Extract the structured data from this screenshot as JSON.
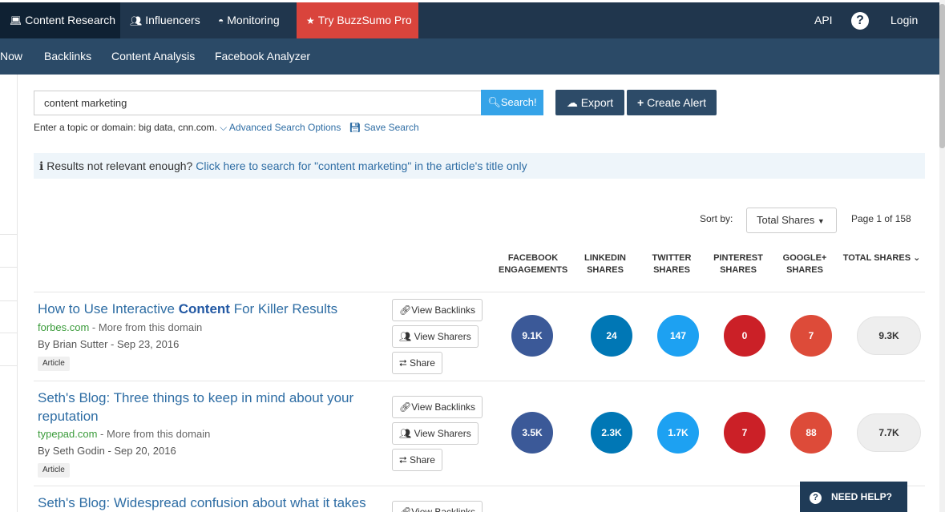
{
  "topnav": {
    "content_research": "Content Research",
    "influencers": "Influencers",
    "monitoring": "Monitoring",
    "try_pro": "Try BuzzSumo Pro",
    "api": "API",
    "help_glyph": "?",
    "login": "Login"
  },
  "subnav": {
    "now": "Now",
    "backlinks": "Backlinks",
    "content_analysis": "Content Analysis",
    "facebook_analyzer": "Facebook Analyzer"
  },
  "search": {
    "value": "content marketing",
    "button": "Search!",
    "export": "Export",
    "create_alert": "Create Alert",
    "hint": "Enter a topic or domain: big data, cnn.com.",
    "advanced": "Advanced Search Options",
    "save": "Save Search"
  },
  "notice": {
    "prefix": "Results not relevant enough?",
    "link": "Click here to search for \"content marketing\" in the article's title only"
  },
  "sort": {
    "label": "Sort by:",
    "selected": "Total Shares",
    "page_info": "Page 1 of 158"
  },
  "columns": [
    {
      "l1": "FACEBOOK",
      "l2": "ENGAGEMENTS"
    },
    {
      "l1": "LINKEDIN",
      "l2": "SHARES"
    },
    {
      "l1": "TWITTER",
      "l2": "SHARES"
    },
    {
      "l1": "PINTEREST",
      "l2": "SHARES"
    },
    {
      "l1": "GOOGLE+",
      "l2": "SHARES"
    },
    {
      "l1": "TOTAL SHARES",
      "l2": ""
    }
  ],
  "actions": {
    "view_backlinks": "View Backlinks",
    "view_sharers": "View Sharers",
    "share": "Share"
  },
  "articles": [
    {
      "title_pre": "How to Use Interactive ",
      "title_bold": "Content",
      "title_post": " For Killer Results",
      "domain": "forbes.com",
      "more": " - More from this domain",
      "byline": "By Brian Sutter - Sep 23, 2016",
      "tag": "Article",
      "facebook": "9.1K",
      "linkedin": "24",
      "twitter": "147",
      "pinterest": "0",
      "googleplus": "7",
      "total": "9.3K"
    },
    {
      "title": "Seth's Blog: Three things to keep in mind about your reputation",
      "domain": "typepad.com",
      "more": " - More from this domain",
      "byline": "By Seth Godin - Sep 20, 2016",
      "tag": "Article",
      "facebook": "3.5K",
      "linkedin": "2.3K",
      "twitter": "1.7K",
      "pinterest": "7",
      "googleplus": "88",
      "total": "7.7K"
    },
    {
      "title": "Seth's Blog: Widespread confusion about what it takes"
    }
  ],
  "help": {
    "glyph": "?",
    "label": "NEED HELP?"
  },
  "colors": {
    "nav": "#20364d",
    "subnav": "#2b4a67",
    "pro": "#d9443c",
    "facebook": "#3b5998",
    "linkedin": "#0077b5",
    "twitter": "#1da1f2",
    "pinterest": "#cb2027",
    "googleplus": "#dd4b39"
  }
}
